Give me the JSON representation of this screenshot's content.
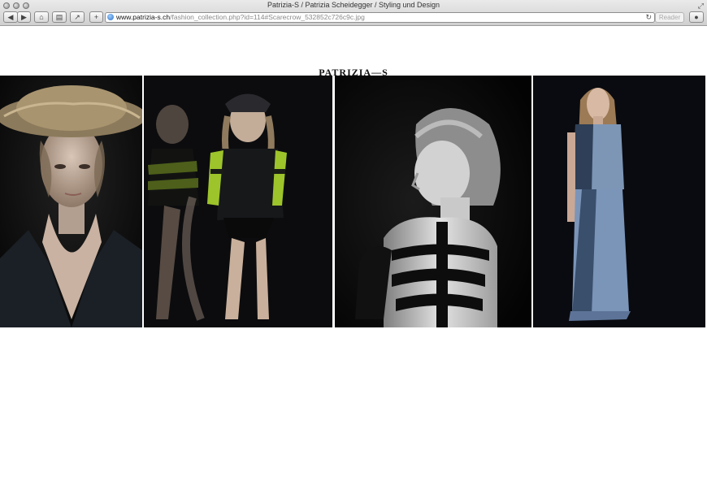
{
  "window": {
    "title": "Patrizia-S / Patrizia Scheidegger / Styling und Design"
  },
  "toolbar": {
    "url_host": "www.patrizia-s.ch",
    "url_path": "/fashion_collection.php?id=114#Scarecrow_532852c726c9c.jpg",
    "reader_label": "Reader"
  },
  "page": {
    "logo": "PATRIZIA—S"
  },
  "gallery": {
    "photos": [
      {
        "name": "model-straw-hat-photo"
      },
      {
        "name": "model-green-stripes-motion-photo"
      },
      {
        "name": "model-harness-back-photo"
      },
      {
        "name": "model-denim-outfit-photo"
      }
    ]
  }
}
